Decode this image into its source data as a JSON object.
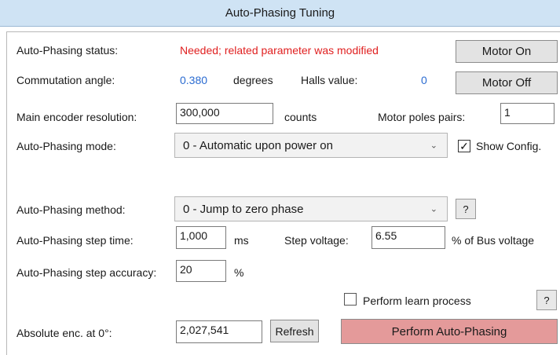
{
  "window": {
    "title": "Auto-Phasing Tuning"
  },
  "status": {
    "label": "Auto-Phasing status:",
    "value": "Needed; related parameter was modified",
    "value_color": "#e02020"
  },
  "commutation": {
    "label": "Commutation angle:",
    "value": "0.380",
    "unit": "degrees",
    "halls_label": "Halls value:",
    "halls_value": "0"
  },
  "buttons": {
    "motor_on": "Motor On",
    "motor_off": "Motor Off",
    "refresh": "Refresh",
    "perform": "Perform Auto-Phasing",
    "help": "?"
  },
  "encoder": {
    "label": "Main encoder resolution:",
    "value": "300,000",
    "unit": "counts",
    "poles_label": "Motor poles pairs:",
    "poles_value": "1"
  },
  "mode": {
    "label": "Auto-Phasing mode:",
    "selected": "0 - Automatic upon power on",
    "show_config_label": "Show Config.",
    "show_config_checked": true
  },
  "method": {
    "label": "Auto-Phasing method:",
    "selected": "0 - Jump to zero phase"
  },
  "step": {
    "time_label": "Auto-Phasing step time:",
    "time_value": "1,000",
    "time_unit": "ms",
    "voltage_label": "Step voltage:",
    "voltage_value": "6.55",
    "voltage_unit": "% of Bus voltage",
    "accuracy_label": "Auto-Phasing step accuracy:",
    "accuracy_value": "20",
    "accuracy_unit": "%"
  },
  "learn": {
    "label": "Perform learn process",
    "checked": false
  },
  "absolute": {
    "label": "Absolute enc. at 0°:",
    "value": "2,027,541"
  },
  "colors": {
    "titlebar": "#cfe3f4",
    "perform_button": "#e49a9a",
    "accent_blue": "#2a6bd1"
  }
}
